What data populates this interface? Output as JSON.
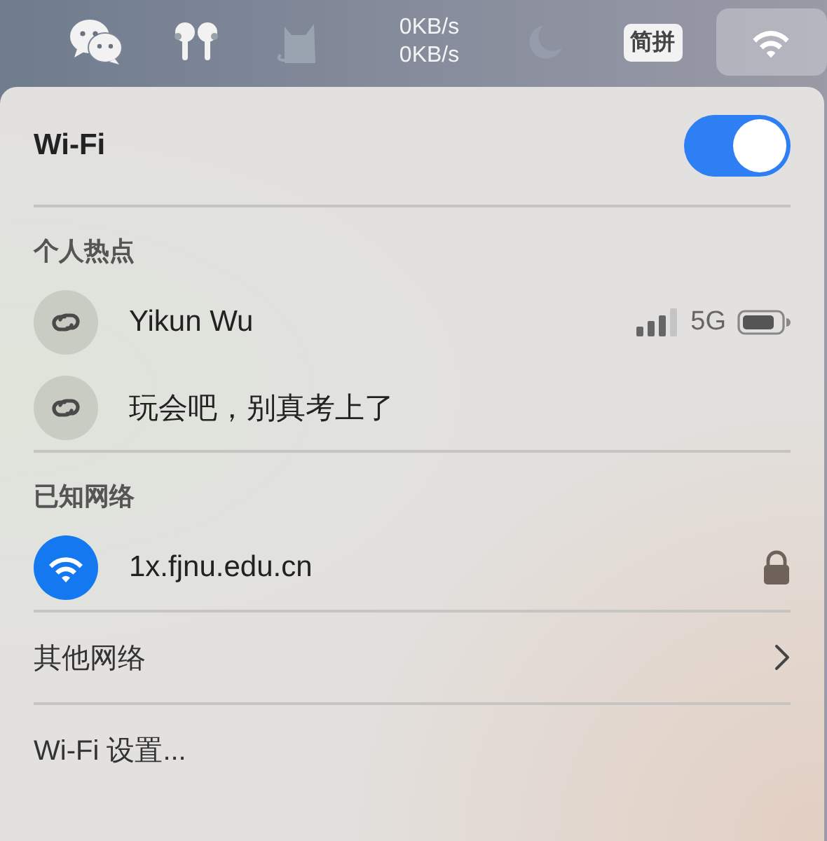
{
  "menu_bar": {
    "items": [
      {
        "kind": "chat",
        "selected": false
      },
      {
        "kind": "earbuds",
        "selected": false
      },
      {
        "kind": "cat",
        "selected": false
      },
      {
        "kind": "speed",
        "lines": [
          "0KB/s",
          "0KB/s"
        ],
        "selected": false
      },
      {
        "kind": "moon",
        "selected": false
      },
      {
        "kind": "input",
        "label": "简拼",
        "selected": false
      },
      {
        "kind": "wifi",
        "selected": true
      }
    ]
  },
  "wifi": {
    "title": "Wi-Fi",
    "on": true
  },
  "hotspot": {
    "heading": "个人热点",
    "items": [
      {
        "name": "Yikun Wu",
        "connected": false,
        "band": "5G"
      },
      {
        "name": "玩会吧，别真考上了",
        "connected": false
      }
    ]
  },
  "known": {
    "heading": "已知网络",
    "items": [
      {
        "name": "1x.fjnu.edu.cn",
        "connected": true,
        "locked": true
      }
    ]
  },
  "other": {
    "label": "其他网络"
  },
  "settings": {
    "label": "Wi-Fi 设置..."
  }
}
